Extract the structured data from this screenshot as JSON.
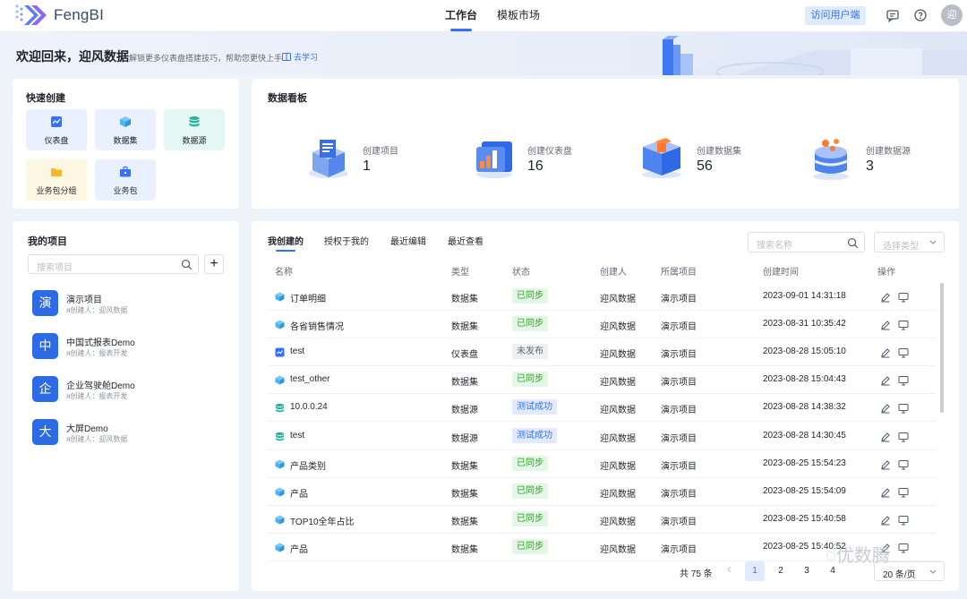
{
  "app": {
    "name": "FengBI",
    "user_initial": "迎"
  },
  "topnav": {
    "tabs": [
      {
        "label": "工作台",
        "active": true
      },
      {
        "label": "模板市场",
        "active": false
      }
    ],
    "visit_button": "访问用户端"
  },
  "banner": {
    "title": "欢迎回来，迎风数据",
    "subtitle": "解锁更多仪表盘搭建技巧，帮助您更快上手",
    "link": "去学习"
  },
  "quick_create": {
    "title": "快速创建",
    "items": [
      {
        "label": "仪表盘",
        "icon": "dashboard-icon",
        "color": "#3370ff",
        "bg": "#e9f1ff"
      },
      {
        "label": "数据集",
        "icon": "cube-icon",
        "color": "#4eb3f0",
        "bg": "#e9f1ff"
      },
      {
        "label": "数据源",
        "icon": "database-icon",
        "color": "#2bb39b",
        "bg": "#e4f7f4"
      },
      {
        "label": "业务包分组",
        "icon": "folder-icon",
        "color": "#f5b72b",
        "bg": "#fdf6e3"
      },
      {
        "label": "业务包",
        "icon": "briefcase-icon",
        "color": "#3370ff",
        "bg": "#e9f1ff"
      }
    ]
  },
  "dashboard_board": {
    "title": "数据看板",
    "stats": [
      {
        "label": "创建项目",
        "value": "1"
      },
      {
        "label": "创建仪表盘",
        "value": "16"
      },
      {
        "label": "创建数据集",
        "value": "56"
      },
      {
        "label": "创建数据源",
        "value": "3"
      }
    ]
  },
  "projects": {
    "title": "我的项目",
    "search_placeholder": "搜索项目",
    "items": [
      {
        "avatar": "演",
        "name": "演示项目",
        "meta": "创建人：迎风数据"
      },
      {
        "avatar": "中",
        "name": "中国式报表Demo",
        "meta": "创建人：报表开发"
      },
      {
        "avatar": "企",
        "name": "企业驾驶舱Demo",
        "meta": "创建人：报表开发"
      },
      {
        "avatar": "大",
        "name": "大屏Demo",
        "meta": "创建人：迎风数据"
      }
    ]
  },
  "table": {
    "tabs": [
      "我创建的",
      "授权于我的",
      "最近编辑",
      "最近查看"
    ],
    "search_placeholder": "搜索名称",
    "type_placeholder": "选择类型",
    "columns": [
      "名称",
      "类型",
      "状态",
      "创建人",
      "所属项目",
      "创建时间",
      "操作"
    ],
    "rows": [
      {
        "icon": "cube-icon",
        "name": "订单明细",
        "type": "数据集",
        "status": "已同步",
        "status_kind": "green",
        "creator": "迎风数据",
        "project": "演示项目",
        "time": "2023-09-01 14:31:18"
      },
      {
        "icon": "cube-icon",
        "name": "各省销售情况",
        "type": "数据集",
        "status": "已同步",
        "status_kind": "green",
        "creator": "迎风数据",
        "project": "演示项目",
        "time": "2023-08-31 10:35:42"
      },
      {
        "icon": "dashboard-icon",
        "name": "test",
        "type": "仪表盘",
        "status": "未发布",
        "status_kind": "gray",
        "creator": "迎风数据",
        "project": "演示项目",
        "time": "2023-08-28 15:05:10"
      },
      {
        "icon": "cube-icon",
        "name": "test_other",
        "type": "数据集",
        "status": "已同步",
        "status_kind": "green",
        "creator": "迎风数据",
        "project": "演示项目",
        "time": "2023-08-28 15:04:43"
      },
      {
        "icon": "database-icon",
        "name": "10.0.0.24",
        "type": "数据源",
        "status": "测试成功",
        "status_kind": "blue",
        "creator": "迎风数据",
        "project": "演示项目",
        "time": "2023-08-28 14:38:32"
      },
      {
        "icon": "database-icon",
        "name": "test",
        "type": "数据源",
        "status": "测试成功",
        "status_kind": "blue",
        "creator": "迎风数据",
        "project": "演示项目",
        "time": "2023-08-28 14:30:45"
      },
      {
        "icon": "cube-icon",
        "name": "产品类别",
        "type": "数据集",
        "status": "已同步",
        "status_kind": "green",
        "creator": "迎风数据",
        "project": "演示项目",
        "time": "2023-08-25 15:54:23"
      },
      {
        "icon": "cube-icon",
        "name": "产品",
        "type": "数据集",
        "status": "已同步",
        "status_kind": "green",
        "creator": "迎风数据",
        "project": "演示项目",
        "time": "2023-08-25 15:54:09"
      },
      {
        "icon": "cube-icon",
        "name": "TOP10全年占比",
        "type": "数据集",
        "status": "已同步",
        "status_kind": "green",
        "creator": "迎风数据",
        "project": "演示项目",
        "time": "2023-08-25 15:40:58"
      },
      {
        "icon": "cube-icon",
        "name": "产品",
        "type": "数据集",
        "status": "已同步",
        "status_kind": "green",
        "creator": "迎风数据",
        "project": "演示项目",
        "time": "2023-08-25 15:40:52"
      }
    ],
    "pagination": {
      "total": "共 75 条",
      "pages": [
        "1",
        "2",
        "3",
        "4"
      ],
      "current": "1",
      "page_size": "20 条/页"
    }
  },
  "watermark": "优数腾"
}
